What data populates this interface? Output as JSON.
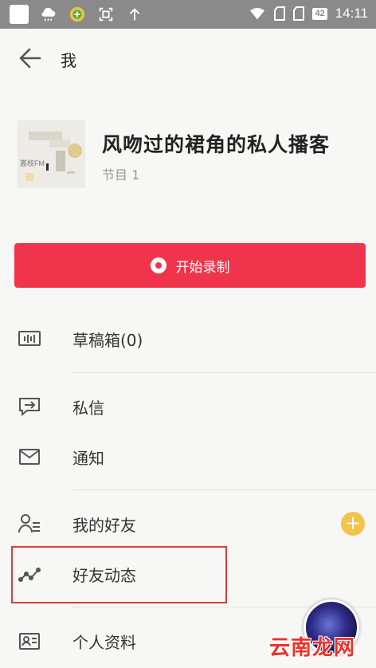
{
  "status_bar": {
    "battery": "42",
    "time": "14:11"
  },
  "header": {
    "title": "我"
  },
  "profile": {
    "cover_label": "荔枝FM",
    "podcast_name": "风吻过的裙角的私人播客",
    "episode_count": "节目 1"
  },
  "record_button": {
    "label": "开始录制",
    "color": "#f0344c"
  },
  "menu": {
    "items": [
      {
        "label": "草稿箱(0)",
        "icon": "drafts-icon"
      },
      {
        "label": "私信",
        "icon": "message-icon"
      },
      {
        "label": "通知",
        "icon": "mail-icon"
      },
      {
        "label": "我的好友",
        "icon": "friends-icon"
      },
      {
        "label": "好友动态",
        "icon": "activity-icon"
      },
      {
        "label": "个人资料",
        "icon": "id-card-icon"
      }
    ]
  },
  "add_friend_button": {
    "symbol": "+"
  },
  "watermark": {
    "text": "云南龙网"
  }
}
